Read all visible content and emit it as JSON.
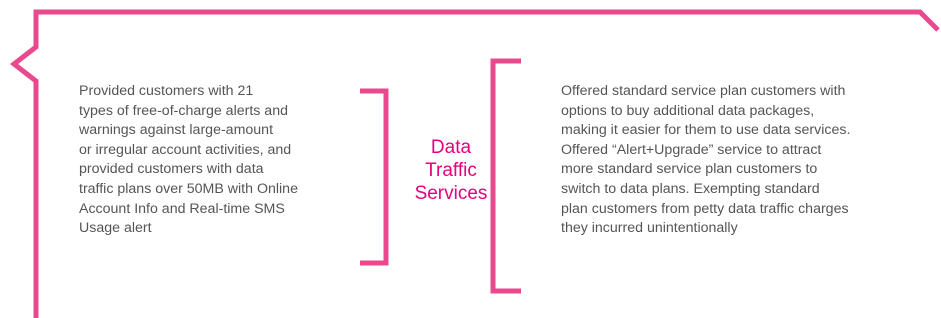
{
  "colors": {
    "accent": "#e6007e",
    "frame": "#e84a8d",
    "text": "#555555"
  },
  "left_panel": {
    "lines": [
      "Provided customers with 21",
      "types of free-of-charge alerts and",
      "warnings against large-amount",
      "or irregular account activities, and",
      "provided customers with data",
      "traffic plans over 50MB with Online",
      "Account Info and Real-time SMS",
      "Usage alert"
    ]
  },
  "center": {
    "title_lines": [
      "Data",
      "Traffic",
      "Services"
    ]
  },
  "right_panel": {
    "lines": [
      "Offered standard service plan customers with",
      "options to buy additional data packages,",
      "making it easier for them to use data services.",
      "Offered “Alert+Upgrade” service to attract",
      "more standard service plan customers to",
      "switch to data plans. Exempting standard",
      "plan customers from petty data traffic charges",
      "they incurred unintentionally"
    ]
  }
}
